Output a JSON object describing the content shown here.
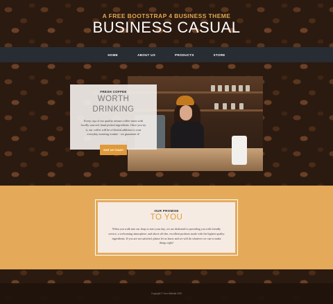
{
  "header": {
    "tagline": "A FREE BOOTSTRAP 4 BUSINESS THEME",
    "brand": "BUSINESS CASUAL"
  },
  "nav": {
    "items": [
      {
        "label": "HOME"
      },
      {
        "label": "ABOUT US"
      },
      {
        "label": "PRODUCTS"
      },
      {
        "label": "STORE"
      }
    ]
  },
  "feature": {
    "eyebrow": "FRESH COFFEE",
    "title_line1": "WORTH",
    "title_line2": "DRINKING",
    "body": "Every cup of our quality artisan coffee starts with locally sourced, hand picked ingredients. Once you try it, our coffee will be a blissful addition to your everyday morning routine - we guarantee it!",
    "button_label": "VISIT US TODAY!"
  },
  "promise": {
    "eyebrow": "OUR PROMISE",
    "title": "TO YOU",
    "body": "When you walk into our shop to start your day, we are dedicated to providing you with friendly service, a welcoming atmosphere, and above all else, excellent products made with the highest quality ingredients. If you are not satisfied, please let us know and we will do whatever we can to make things right!"
  },
  "footer": {
    "copyright": "Copyright © Your Website 2020"
  },
  "colors": {
    "accent": "#e09a3a",
    "band": "#e4aa5a",
    "navbar": "#282e36",
    "tagline": "#e4a853"
  }
}
